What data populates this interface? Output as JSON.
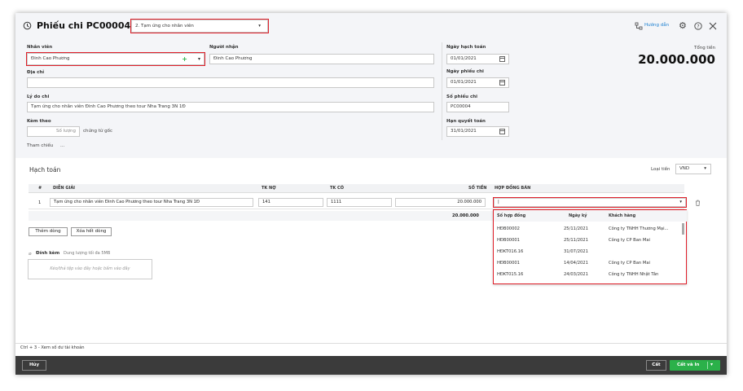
{
  "header": {
    "title": "Phiếu chi PC00004",
    "type_select": "2. Tạm ứng cho nhân viên",
    "guide": "Hướng dẫn"
  },
  "form": {
    "employee_label": "Nhân viên",
    "employee_value": "Đinh  Cao Phương",
    "receiver_label": "Người nhận",
    "receiver_value": "Đinh  Cao Phương",
    "address_label": "Địa chỉ",
    "address_value": "",
    "reason_label": "Lý do chi",
    "reason_value": "Tạm ứng cho nhân viên Đinh Cao Phương theo tour Nha Trang 3N 1Đ",
    "attach_label": "Kèm theo",
    "attach_placeholder": "Số lượng",
    "attach_suffix": "chứng từ gốc",
    "reference": "Tham chiếu",
    "reference_more": "..."
  },
  "dates": {
    "posting_label": "Ngày hạch toán",
    "posting_value": "01/01/2021",
    "voucher_date_label": "Ngày phiếu chi",
    "voucher_date_value": "01/01/2021",
    "voucher_no_label": "Số phiếu chi",
    "voucher_no_value": "PC00004",
    "settle_label": "Hạn quyết toán",
    "settle_value": "31/01/2021"
  },
  "total": {
    "label": "Tổng tiền",
    "value": "20.000.000"
  },
  "accounting": {
    "title": "Hạch toán",
    "currency_label": "Loại tiền",
    "currency_value": "VND",
    "columns": [
      "#",
      "DIỄN GIẢI",
      "TK NỢ",
      "TK CÓ",
      "SỐ TIỀN",
      "HỢP ĐỒNG BÁN"
    ],
    "rows": [
      {
        "no": "1",
        "desc": "Tạm ứng cho nhân viên Đinh Cao Phương theo tour Nha Trang 3N 1Đ",
        "debit": "141",
        "credit": "1111",
        "amount": "20.000.000",
        "contract": "|"
      }
    ],
    "sum": "20.000.000",
    "add_row": "Thêm dòng",
    "clear_rows": "Xóa hết dòng"
  },
  "dropdown": {
    "columns": [
      "Số hợp đồng",
      "Ngày ký",
      "Khách hàng"
    ],
    "rows": [
      {
        "no": "HĐB00002",
        "date": "25/11/2021",
        "customer": "Công ty TNHH Thương Mại..."
      },
      {
        "no": "HĐB00001",
        "date": "25/11/2021",
        "customer": "Công ty CP Ban Mai"
      },
      {
        "no": "HĐKT016.16",
        "date": "31/07/2021",
        "customer": ""
      },
      {
        "no": "HĐB00001",
        "date": "14/04/2021",
        "customer": "Công ty CP Ban Mai"
      },
      {
        "no": "HĐKT015.16",
        "date": "24/03/2021",
        "customer": "Công ty TNHH Nhật Tân"
      }
    ]
  },
  "attachment": {
    "label": "Đính kèm",
    "limit": "Dung lượng tối đa 5MB",
    "drop_text": "Kéo/thả tệp vào đây hoặc bấm vào đây"
  },
  "status": {
    "hint": "Ctrl + 3 - Xem số dư tài khoản"
  },
  "footer": {
    "cancel": "Hủy",
    "save": "Cất",
    "save_print": "Cất và In"
  },
  "colors": {
    "accent": "#2bb14a",
    "highlight": "#e0202a",
    "footer": "#3b3b3b",
    "link": "#1a7fd0"
  }
}
